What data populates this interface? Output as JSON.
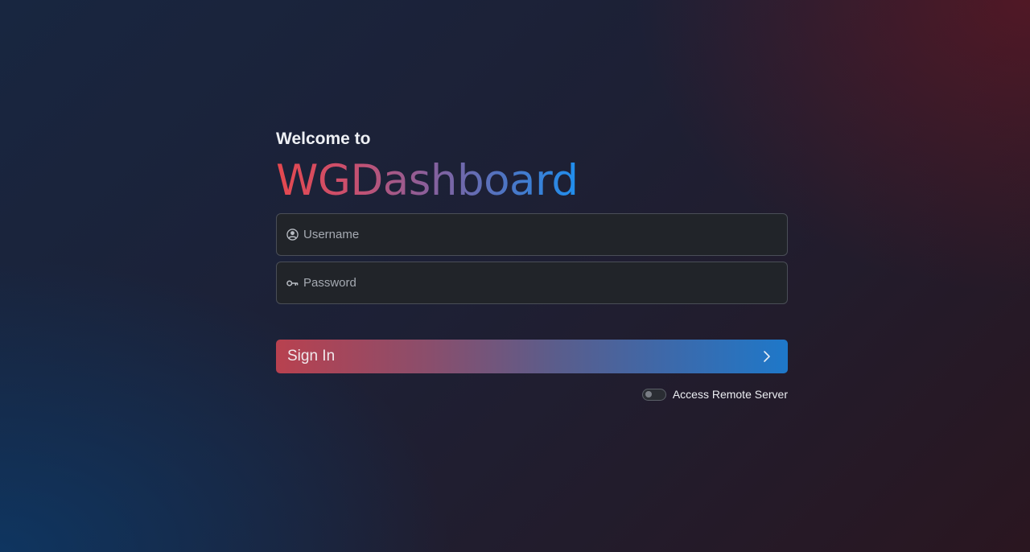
{
  "login": {
    "welcome_text": "Welcome to",
    "brand_name": "WGDashboard",
    "username": {
      "placeholder": "Username",
      "value": "",
      "icon": "person-circle-icon"
    },
    "password": {
      "placeholder": "Password",
      "value": "",
      "icon": "key-icon"
    },
    "sign_in": {
      "label": "Sign In",
      "icon": "chevron-right-icon"
    },
    "remote_server": {
      "label": "Access Remote Server",
      "enabled": false
    }
  },
  "colors": {
    "brand_gradient_start": "#e5484e",
    "brand_gradient_end": "#1f8fef",
    "button_gradient_start": "#b8414f",
    "button_gradient_end": "#1e78c9"
  }
}
